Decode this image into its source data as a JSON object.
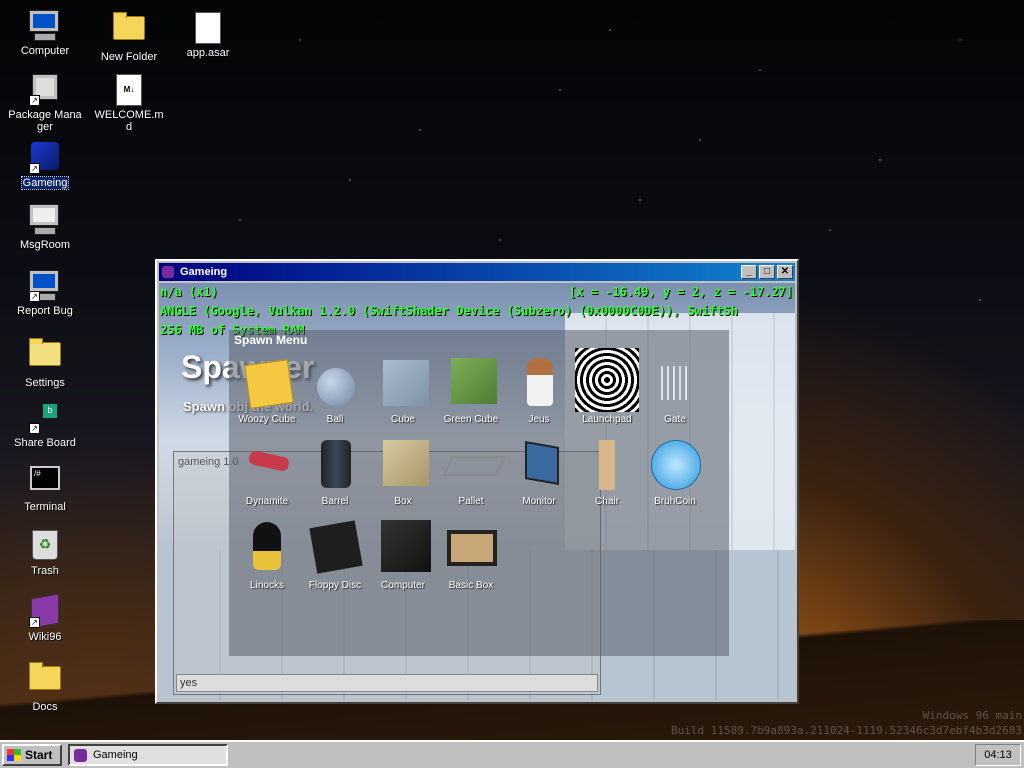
{
  "desktop": {
    "icons": [
      {
        "label": "Computer",
        "icon": "computer-icon"
      },
      {
        "label": "New Folder",
        "icon": "folder-icon"
      },
      {
        "label": "app.asar",
        "icon": "file-icon"
      },
      {
        "label": "Package Manager",
        "icon": "package-manager-icon"
      },
      {
        "label": "WELCOME.md",
        "icon": "markdown-file-icon"
      },
      {
        "label": "Gameing",
        "icon": "gameing-icon"
      },
      {
        "label": "MsgRoom",
        "icon": "msgroom-icon"
      },
      {
        "label": "Report Bug",
        "icon": "report-bug-icon"
      },
      {
        "label": "Settings",
        "icon": "settings-icon"
      },
      {
        "label": "Share Board",
        "icon": "share-board-icon"
      },
      {
        "label": "Terminal",
        "icon": "terminal-icon"
      },
      {
        "label": "Trash",
        "icon": "trash-icon"
      },
      {
        "label": "Wiki96",
        "icon": "wiki-icon"
      },
      {
        "label": "Docs",
        "icon": "folder-icon"
      }
    ]
  },
  "window": {
    "title": "Gameing",
    "buttons": {
      "minimize": "_",
      "maximize": "□",
      "close": "✕"
    },
    "hud": {
      "mode": "n/a (x1)",
      "coords": "[x = -16.49, y = 2, z = -17.27]",
      "renderer": "ANGLE (Google, Vulkan 1.2.0 (SwiftShader Device (Subzero) (0x0000C0DE)), SwiftSh",
      "memory": "256 MB of System RAM"
    },
    "spawner": {
      "title": "Spawner",
      "subtitle": "Spawn      obj      the world."
    },
    "console": {
      "version": "gameing 1.0",
      "input_value": "yes"
    },
    "spawn_menu": {
      "title": "Spawn Menu",
      "items": [
        {
          "label": "Woozy Cube"
        },
        {
          "label": "Ball"
        },
        {
          "label": "Cube"
        },
        {
          "label": "Green Cube"
        },
        {
          "label": "Jeus"
        },
        {
          "label": "Launchpad"
        },
        {
          "label": "Gate"
        },
        {
          "label": "Dynamite"
        },
        {
          "label": "Barrel"
        },
        {
          "label": "Box"
        },
        {
          "label": "Pallet"
        },
        {
          "label": "Monitor"
        },
        {
          "label": "Chair"
        },
        {
          "label": "BruhCoin"
        },
        {
          "label": "Linocks"
        },
        {
          "label": "Floppy Disc"
        },
        {
          "label": "Computer"
        },
        {
          "label": "Basic Box"
        }
      ]
    }
  },
  "watermark": {
    "line1": "Windows 96 main",
    "line2": "Build 11589.7b9a893a.211024-1119.52346c3d7ebf4b3d2683"
  },
  "taskbar": {
    "start_label": "Start",
    "task_label": "Gameing",
    "clock": "04:13"
  }
}
